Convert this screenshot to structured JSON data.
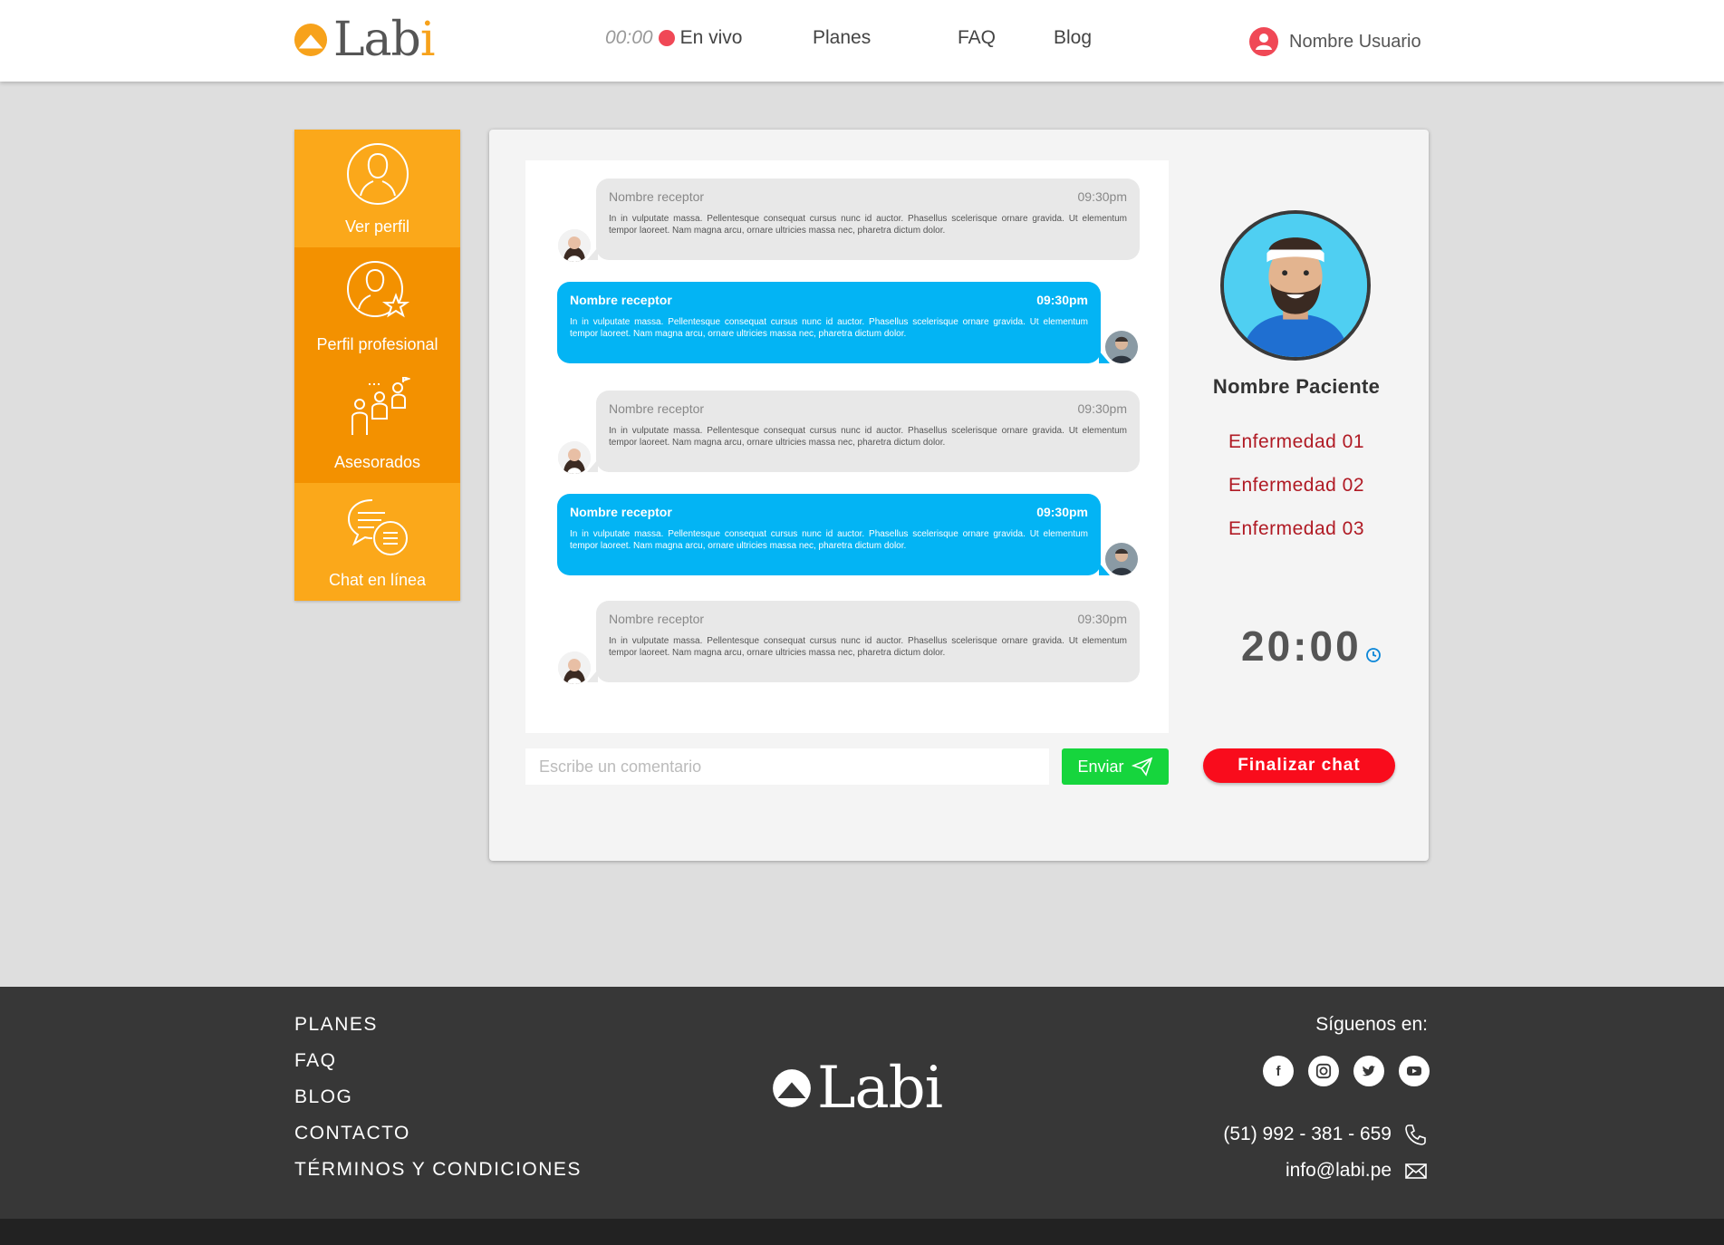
{
  "header": {
    "logo_text": "Labi",
    "live_time": "00:00",
    "live_label": "En vivo",
    "nav": {
      "planes": "Planes",
      "faq": "FAQ",
      "blog": "Blog"
    },
    "user_name": "Nombre Usuario"
  },
  "sidebar": {
    "items": [
      {
        "label": "Ver perfil",
        "icon": "user-profile-icon"
      },
      {
        "label": "Perfil profesional",
        "icon": "professional-profile-icon"
      },
      {
        "label": "Asesorados",
        "icon": "advisees-icon"
      },
      {
        "label": "Chat en línea",
        "icon": "chat-icon"
      }
    ]
  },
  "chat": {
    "messages": [
      {
        "type": "received",
        "name": "Nombre receptor",
        "time": "09:30pm",
        "text": "In in vulputate massa. Pellentesque consequat cursus nunc id auctor. Phasellus scelerisque ornare gravida. Ut elementum tempor laoreet. Nam magna arcu, ornare ultricies massa nec, pharetra dictum dolor."
      },
      {
        "type": "sent",
        "name": "Nombre receptor",
        "time": "09:30pm",
        "text": "In in vulputate massa. Pellentesque consequat cursus nunc id auctor. Phasellus scelerisque ornare gravida. Ut elementum tempor laoreet. Nam magna arcu, ornare ultricies massa nec, pharetra dictum dolor."
      },
      {
        "type": "received",
        "name": "Nombre receptor",
        "time": "09:30pm",
        "text": "In in vulputate massa. Pellentesque consequat cursus nunc id auctor. Phasellus scelerisque ornare gravida. Ut elementum tempor laoreet. Nam magna arcu, ornare ultricies massa nec, pharetra dictum dolor."
      },
      {
        "type": "sent",
        "name": "Nombre receptor",
        "time": "09:30pm",
        "text": "In in vulputate massa. Pellentesque consequat cursus nunc id auctor. Phasellus scelerisque ornare gravida. Ut elementum tempor laoreet. Nam magna arcu, ornare ultricies massa nec, pharetra dictum dolor."
      },
      {
        "type": "received",
        "name": "Nombre receptor",
        "time": "09:30pm",
        "text": "In in vulputate massa. Pellentesque consequat cursus nunc id auctor. Phasellus scelerisque ornare gravida. Ut elementum tempor laoreet. Nam magna arcu, ornare ultricies massa nec, pharetra dictum dolor."
      }
    ],
    "comment_placeholder": "Escribe un comentario",
    "send_label": "Enviar"
  },
  "patient": {
    "name": "Nombre Paciente",
    "diseases": [
      "Enfermedad 01",
      "Enfermedad 02",
      "Enfermedad 03"
    ],
    "timer": "20:00",
    "end_label": "Finalizar chat"
  },
  "footer": {
    "links": [
      "PLANES",
      "FAQ",
      "BLOG",
      "CONTACTO",
      "TÉRMINOS Y CONDICIONES"
    ],
    "logo_text": "Labi",
    "follow_label": "Síguenos en:",
    "social": [
      "facebook-icon",
      "instagram-icon",
      "twitter-icon",
      "youtube-icon"
    ],
    "phone": "(51) 992 - 381 - 659",
    "email": "info@labi.pe"
  },
  "colors": {
    "brand_orange": "#fba81a",
    "brand_orange_dark": "#f39100",
    "sent_bubble": "#03b4f4",
    "send_button": "#16d53d",
    "end_button": "#f90c1c",
    "disease_text": "#b01a24",
    "footer_bg": "#373737"
  }
}
